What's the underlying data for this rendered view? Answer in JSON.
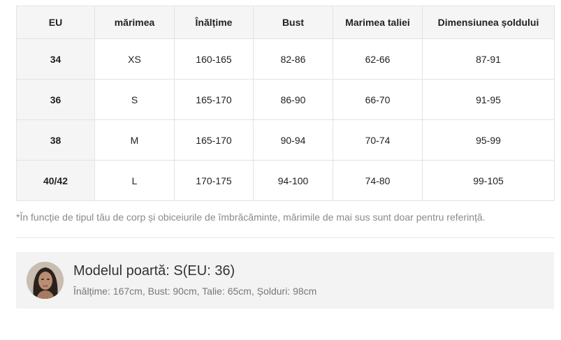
{
  "table": {
    "headers": [
      "EU",
      "mărimea",
      "Înălțime",
      "Bust",
      "Marimea taliei",
      "Dimensiunea șoldului"
    ],
    "rows": [
      [
        "34",
        "XS",
        "160-165",
        "82-86",
        "62-66",
        "87-91"
      ],
      [
        "36",
        "S",
        "165-170",
        "86-90",
        "66-70",
        "91-95"
      ],
      [
        "38",
        "M",
        "165-170",
        "90-94",
        "70-74",
        "95-99"
      ],
      [
        "40/42",
        "L",
        "170-175",
        "94-100",
        "74-80",
        "99-105"
      ]
    ]
  },
  "note": "*În funcție de tipul tău de corp și obiceiurile de îmbrăcăminte, mărimile de mai sus sunt doar pentru referință.",
  "model": {
    "title": "Modelul poartă: S(EU: 36)",
    "measurements": "Înălțime: 167cm, Bust: 90cm, Talie: 65cm, Șolduri: 98cm"
  }
}
